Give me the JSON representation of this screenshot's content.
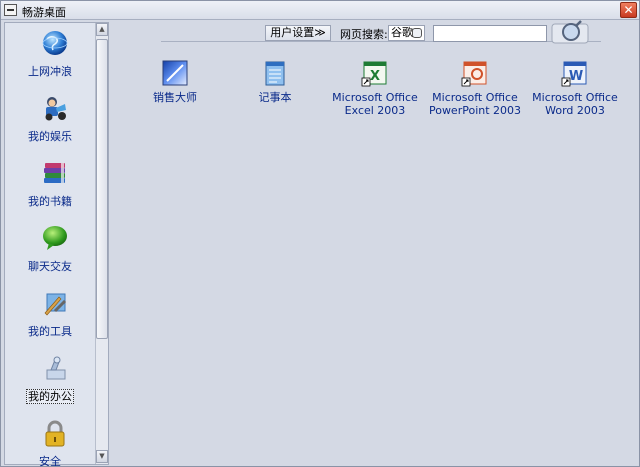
{
  "window": {
    "title": "畅游桌面",
    "close_glyph": "✕"
  },
  "toolbar": {
    "user_settings": "用户设置",
    "user_settings_glyph": "≫",
    "search_label": "网页搜索:",
    "engine": "谷歌",
    "search_value": ""
  },
  "sidebar": {
    "items": [
      {
        "label": "上网冲浪",
        "icon": "globe-icon"
      },
      {
        "label": "我的娱乐",
        "icon": "entertainment-icon"
      },
      {
        "label": "我的书籍",
        "icon": "books-icon"
      },
      {
        "label": "聊天交友",
        "icon": "chat-bubble-icon"
      },
      {
        "label": "我的工具",
        "icon": "tools-icon"
      },
      {
        "label": "我的办公",
        "icon": "office-icon"
      },
      {
        "label": "安全",
        "icon": "lock-icon"
      }
    ],
    "active_index": 5
  },
  "apps": [
    {
      "line1": "销售大师",
      "line2": "",
      "icon": "sales-master-icon"
    },
    {
      "line1": "记事本",
      "line2": "",
      "icon": "notepad-icon"
    },
    {
      "line1": "Microsoft Office",
      "line2": "Excel 2003",
      "icon": "excel-icon"
    },
    {
      "line1": "Microsoft Office",
      "line2": "PowerPoint 2003",
      "icon": "powerpoint-icon"
    },
    {
      "line1": "Microsoft Office",
      "line2": "Word 2003",
      "icon": "word-icon"
    }
  ],
  "colors": {
    "label_blue": "#0a2a8a",
    "excel_green": "#1e7b34",
    "ppt_orange": "#d0522a",
    "word_blue": "#2b5bb5"
  }
}
